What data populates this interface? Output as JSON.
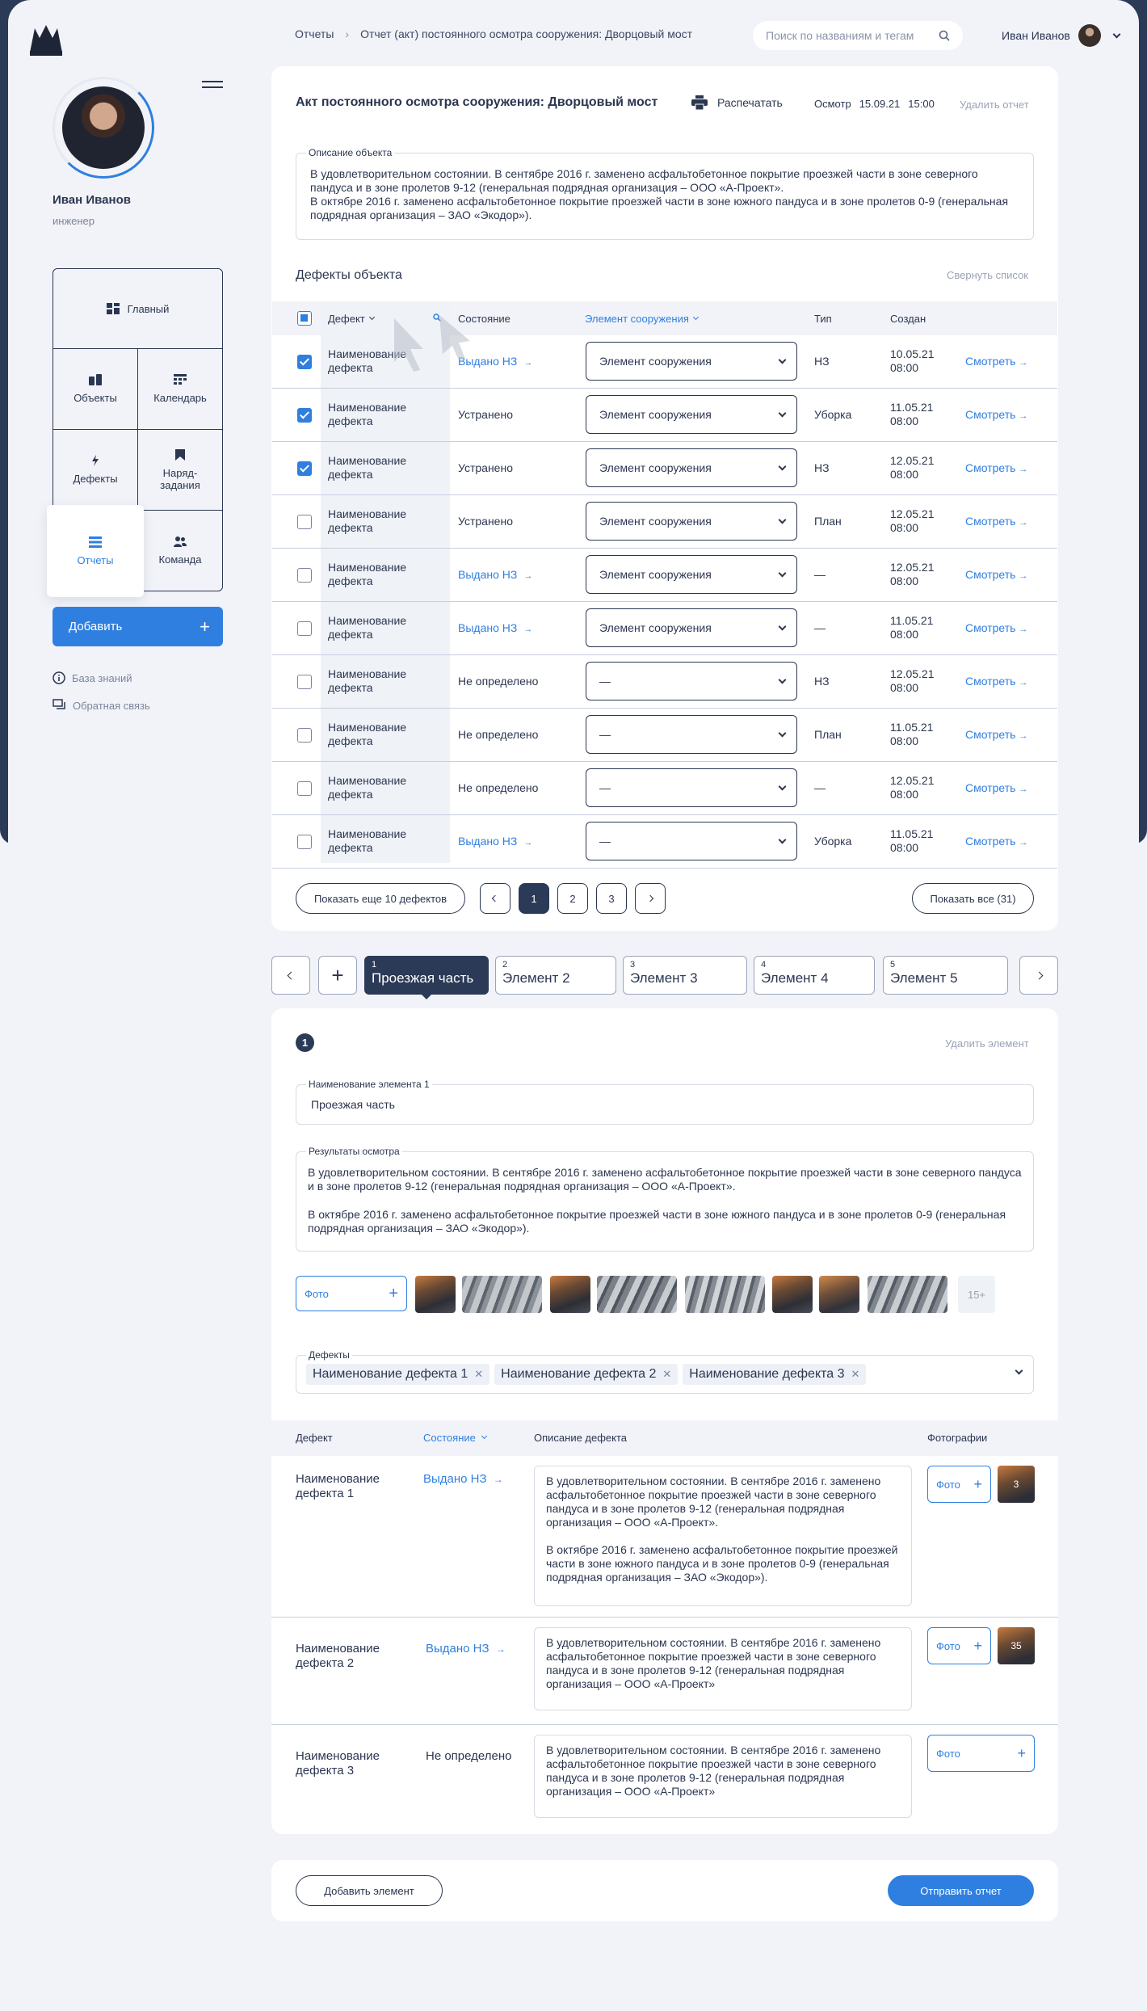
{
  "header": {
    "crumb_root": "Отчеты",
    "crumb_current": "Отчет (акт) постоянного осмотра сооружения: Дворцовый мост",
    "search_placeholder": "Поиск по названиям и тегам",
    "user_name": "Иван Иванов"
  },
  "sidebar": {
    "user_name": "Иван Иванов",
    "user_role": "инженер",
    "menu": {
      "main": "Главный",
      "objects": "Объекты",
      "calendar": "Календарь",
      "defects": "Дефекты",
      "orders": "Наряд-задания",
      "reports": "Отчеты",
      "team": "Команда"
    },
    "add_label": "Добавить",
    "knowledge": "База знаний",
    "feedback": "Обратная связь"
  },
  "report": {
    "title": "Акт постоянного осмотра сооружения: Дворцовый мост",
    "print": "Распечатать",
    "inspection_label": "Осмотр",
    "inspection_date": "15.09.21",
    "inspection_time": "15:00",
    "delete": "Удалить отчет",
    "desc_legend": "Описание объекта",
    "desc_line1": "В удовлетворительном состоянии. В сентябре 2016 г. заменено асфальтобетонное покрытие проезжей части в зоне северного пандуса и в зоне пролетов 9-12 (генеральная подрядная организация – ООО «А-Проект».",
    "desc_line2": "В октябре 2016 г. заменено асфальтобетонное покрытие проезжей части в зоне южного пандуса и в зоне пролетов 0-9 (генеральная подрядная организация – ЗАО «Экодор»)."
  },
  "defects": {
    "heading": "Дефекты объекта",
    "collapse": "Свернуть список",
    "columns": {
      "defect": "Дефект",
      "state": "Состояние",
      "element": "Элемент сооружения",
      "type": "Тип",
      "created": "Создан"
    },
    "rows": [
      {
        "name": "Наименование дефекта",
        "state": "Выдано НЗ",
        "element": "Элемент сооружения",
        "type": "НЗ",
        "date": "10.05.21",
        "time": "08:00",
        "view": "Смотреть"
      },
      {
        "name": "Наименование дефекта",
        "state": "Устранено",
        "element": "Элемент сооружения",
        "type": "Уборка",
        "date": "11.05.21",
        "time": "08:00",
        "view": "Смотреть"
      },
      {
        "name": "Наименование дефекта",
        "state": "Устранено",
        "element": "Элемент сооружения",
        "type": "НЗ",
        "date": "12.05.21",
        "time": "08:00",
        "view": "Смотреть"
      },
      {
        "name": "Наименование дефекта",
        "state": "Устранено",
        "element": "Элемент сооружения",
        "type": "План",
        "date": "12.05.21",
        "time": "08:00",
        "view": "Смотреть"
      },
      {
        "name": "Наименование дефекта",
        "state": "Выдано НЗ",
        "element": "Элемент сооружения",
        "type": "—",
        "date": "12.05.21",
        "time": "08:00",
        "view": "Смотреть"
      },
      {
        "name": "Наименование дефекта",
        "state": "Выдано НЗ",
        "element": "Элемент сооружения",
        "type": "—",
        "date": "11.05.21",
        "time": "08:00",
        "view": "Смотреть"
      },
      {
        "name": "Наименование дефекта",
        "state": "Не определено",
        "element": "—",
        "type": "НЗ",
        "date": "12.05.21",
        "time": "08:00",
        "view": "Смотреть"
      },
      {
        "name": "Наименование дефекта",
        "state": "Не определено",
        "element": "—",
        "type": "План",
        "date": "11.05.21",
        "time": "08:00",
        "view": "Смотреть"
      },
      {
        "name": "Наименование дефекта",
        "state": "Не определено",
        "element": "—",
        "type": "—",
        "date": "12.05.21",
        "time": "08:00",
        "view": "Смотреть"
      },
      {
        "name": "Наименование дефекта",
        "state": "Выдано НЗ",
        "element": "—",
        "type": "Уборка",
        "date": "11.05.21",
        "time": "08:00",
        "view": "Смотреть"
      }
    ],
    "show_more": "Показать еще 10 дефектов",
    "pages": [
      "1",
      "2",
      "3"
    ],
    "show_all": "Показать все (31)"
  },
  "elements": {
    "tabs": [
      {
        "num": "1",
        "title": "Проезжая часть"
      },
      {
        "num": "2",
        "title": "Элемент 2"
      },
      {
        "num": "3",
        "title": "Элемент 3"
      },
      {
        "num": "4",
        "title": "Элемент 4"
      },
      {
        "num": "5",
        "title": "Элемент 5"
      }
    ],
    "badge": "1",
    "delete": "Удалить элемент",
    "name_legend": "Наименование элемента 1",
    "name_value": "Проезжая часть",
    "results_legend": "Результаты осмотра",
    "results_p1": "В удовлетворительном состоянии. В сентябре 2016 г. заменено асфальтобетонное покрытие проезжей части в зоне северного пандуса и в зоне пролетов 9-12 (генеральная подрядная организация – ООО «А-Проект».",
    "results_p2": "В октябре 2016 г. заменено асфальтобетонное покрытие проезжей части в зоне южного пандуса и в зоне пролетов 0-9 (генеральная подрядная организация – ЗАО «Экодор»).",
    "photo_label": "Фото",
    "photo_more": "15+",
    "defects_legend": "Дефекты",
    "chips": [
      "Наименование дефекта 1",
      "Наименование дефекта 2",
      "Наименование дефекта 3"
    ],
    "table_cols": {
      "defect": "Дефект",
      "state": "Состояние",
      "desc": "Описание дефекта",
      "photos": "Фотографии"
    },
    "table_rows": [
      {
        "name": "Наименование дефекта 1",
        "state": "Выдано НЗ",
        "desc1": "В удовлетворительном состоянии. В сентябре 2016 г. заменено асфальтобетонное покрытие проезжей части в зоне северного пандуса и в зоне пролетов 9-12 (генеральная подрядная организация – ООО «А-Проект».",
        "desc2": "В октябре 2016 г. заменено асфальтобетонное покрытие проезжей части в зоне южного пандуса и в зоне пролетов 0-9 (генеральная подрядная организация – ЗАО «Экодор»).",
        "photo_count": "3"
      },
      {
        "name": "Наименование дефекта 2",
        "state": "Выдано НЗ",
        "desc1": "В удовлетворительном состоянии. В сентябре 2016 г. заменено асфальтобетонное покрытие проезжей части в зоне северного пандуса и в зоне пролетов 9-12 (генеральная подрядная организация – ООО «А-Проект»",
        "photo_count": "35"
      },
      {
        "name": "Наименование дефекта 3",
        "state": "Не определено",
        "desc1": "В удовлетворительном состоянии. В сентябре 2016 г. заменено асфальтобетонное покрытие проезжей части в зоне северного пандуса и в зоне пролетов 9-12 (генеральная подрядная организация – ООО «А-Проект»"
      }
    ]
  },
  "footer": {
    "add_element": "Добавить элемент",
    "send": "Отправить отчет"
  },
  "colors": {
    "navy": "#2b3a57",
    "accent": "#2f7fe0",
    "background": "#f1f3f8"
  }
}
